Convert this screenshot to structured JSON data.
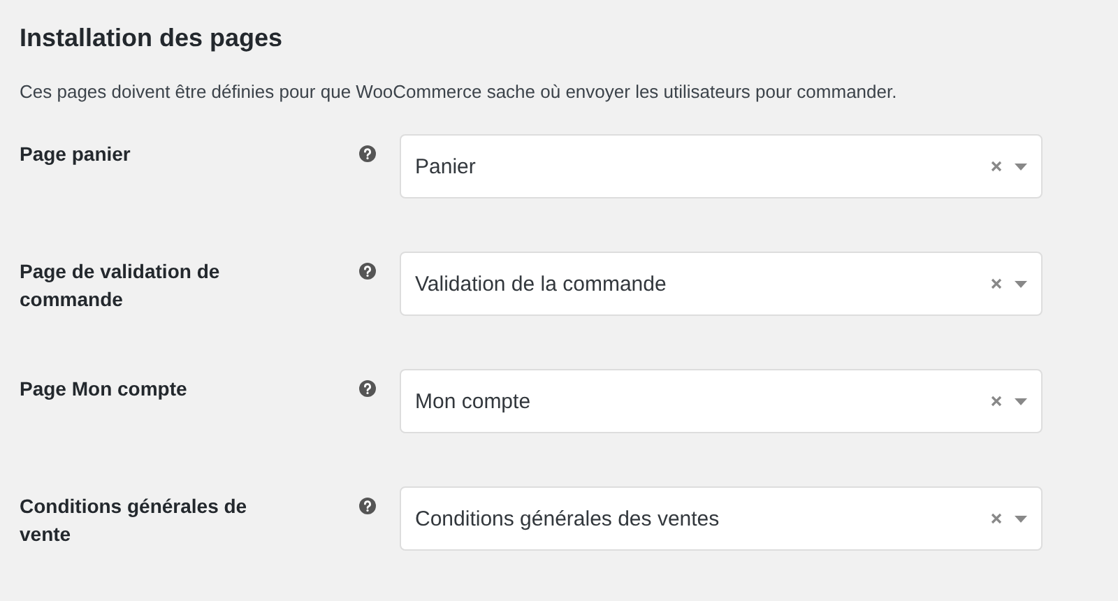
{
  "title": "Installation des pages",
  "description": "Ces pages doivent être définies pour que WooCommerce sache où envoyer les utilisateurs pour commander.",
  "settings": [
    {
      "label": "Page panier",
      "value": "Panier"
    },
    {
      "label": "Page de validation de commande",
      "value": "Validation de la commande"
    },
    {
      "label": "Page Mon compte",
      "value": "Mon compte"
    },
    {
      "label": "Conditions générales de vente",
      "value": "Conditions générales des ventes"
    }
  ]
}
